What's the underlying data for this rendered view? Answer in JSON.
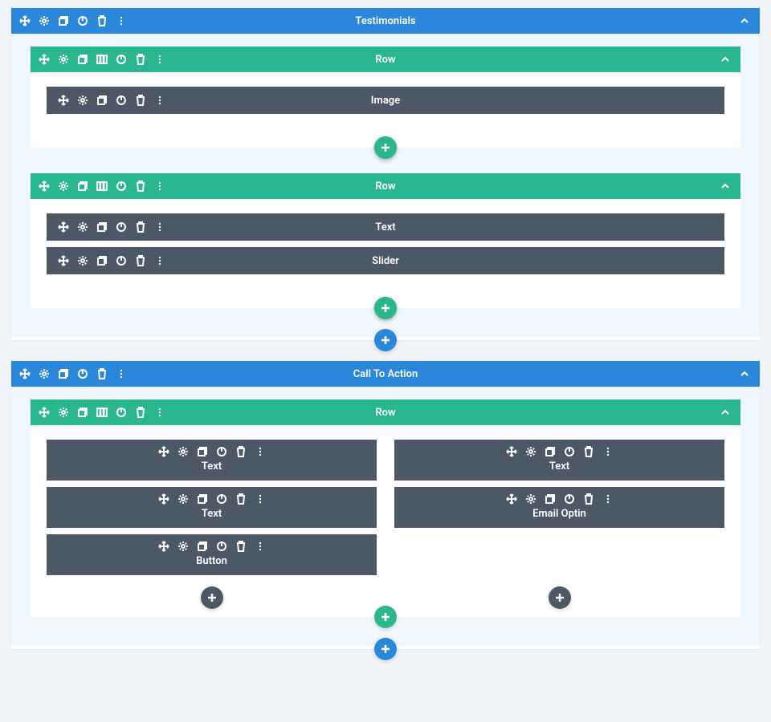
{
  "colors": {
    "section": "#2b87da",
    "row": "#2ab78f",
    "module": "#4c5866"
  },
  "sections": [
    {
      "title": "Testimonials",
      "rows": [
        {
          "title": "Row",
          "columns": [
            {
              "modules": [
                {
                  "label": "Image"
                }
              ]
            }
          ]
        },
        {
          "title": "Row",
          "columns": [
            {
              "modules": [
                {
                  "label": "Text"
                },
                {
                  "label": "Slider"
                }
              ]
            }
          ]
        }
      ]
    },
    {
      "title": "Call To Action",
      "rows": [
        {
          "title": "Row",
          "columns": [
            {
              "modules": [
                {
                  "label": "Text"
                },
                {
                  "label": "Text"
                },
                {
                  "label": "Button"
                }
              ]
            },
            {
              "modules": [
                {
                  "label": "Text"
                },
                {
                  "label": "Email Optin"
                }
              ]
            }
          ]
        }
      ]
    }
  ]
}
